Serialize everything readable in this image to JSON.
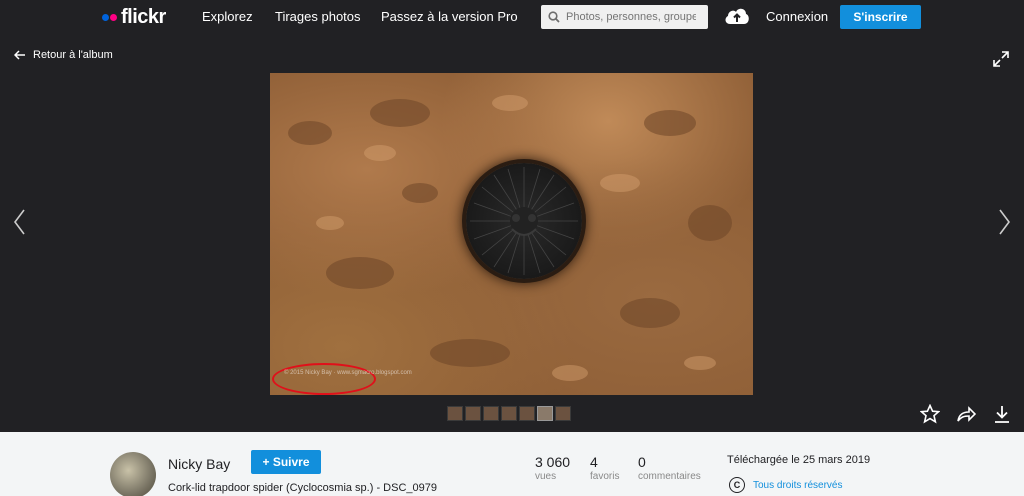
{
  "header": {
    "logo_text": "flickr",
    "nav": [
      "Explorez",
      "Tirages photos",
      "Passez à la version Pro"
    ],
    "search_placeholder": "Photos, personnes, groupes",
    "login": "Connexion",
    "signup": "S'inscrire"
  },
  "viewer": {
    "back_label": "Retour à l'album",
    "watermark": "© 2015 Nicky Bay · www.sgmacro.blogspot.com",
    "thumbnail_count": 7,
    "active_thumbnail": 6
  },
  "info": {
    "author": "Nicky Bay",
    "follow_label": "+ Suivre",
    "title": "Cork-lid trapdoor spider (Cyclocosmia sp.) - DSC_0979",
    "stats": [
      {
        "value": "3 060",
        "label": "vues"
      },
      {
        "value": "4",
        "label": "favoris"
      },
      {
        "value": "0",
        "label": "commentaires"
      }
    ],
    "uploaded": "Téléchargée le 25 mars 2019",
    "rights": "Tous droits réservés",
    "rights_icon": "C"
  },
  "colors": {
    "accent": "#128fdc",
    "bg_dark": "#212124",
    "logo_blue": "#0063dc",
    "logo_pink": "#ff0084",
    "annotation_red": "#e0101a"
  }
}
